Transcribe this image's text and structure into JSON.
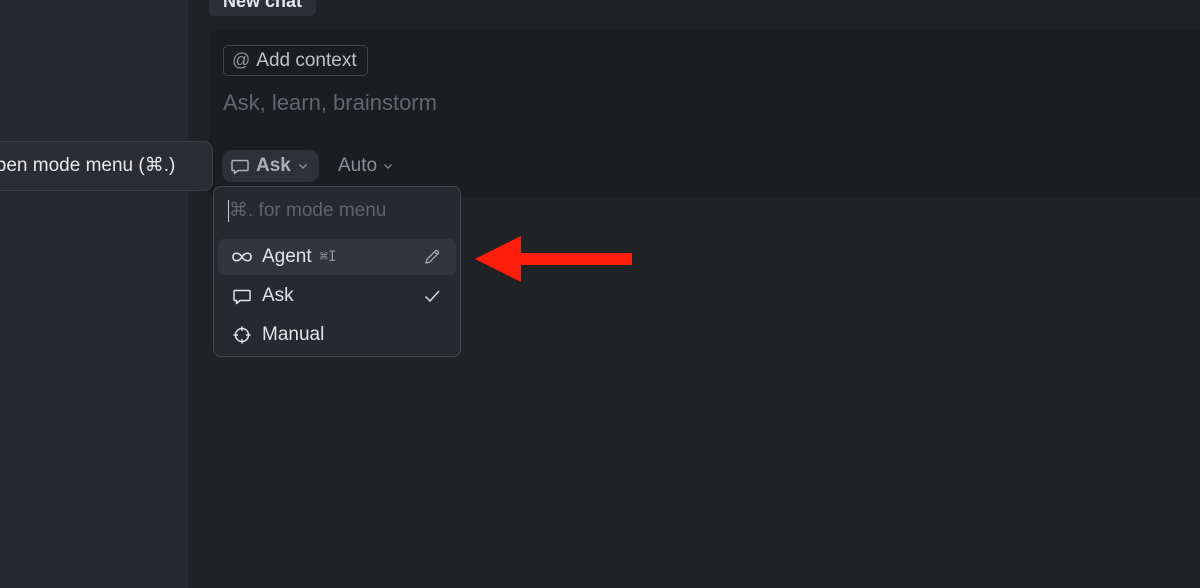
{
  "chat": {
    "tab_label": "New chat"
  },
  "composer": {
    "add_context_label": "Add context",
    "placeholder": "Ask, learn, brainstorm",
    "mode_button_label": "Ask",
    "model_button_label": "Auto"
  },
  "tooltip": {
    "text": "Open mode menu (⌘.)"
  },
  "mode_menu": {
    "search_placeholder": "⌘. for mode menu",
    "items": [
      {
        "label": "Agent",
        "shortcut": "⌘I",
        "icon": "infinity-icon",
        "trailing_icon": "pencil-icon",
        "highlighted": true
      },
      {
        "label": "Ask",
        "shortcut": "",
        "icon": "chat-bubble-icon",
        "trailing_icon": "checkmark-icon",
        "highlighted": false
      },
      {
        "label": "Manual",
        "shortcut": "",
        "icon": "crosshair-icon",
        "trailing_icon": "",
        "highlighted": false
      }
    ],
    "selected": "Ask"
  },
  "annotation": {
    "arrow_color": "#ff1d0b",
    "icon": "red-arrow-left-icon"
  },
  "colors": {
    "background": "#212226",
    "sidebar": "#272930",
    "menu_background": "#27292f"
  }
}
